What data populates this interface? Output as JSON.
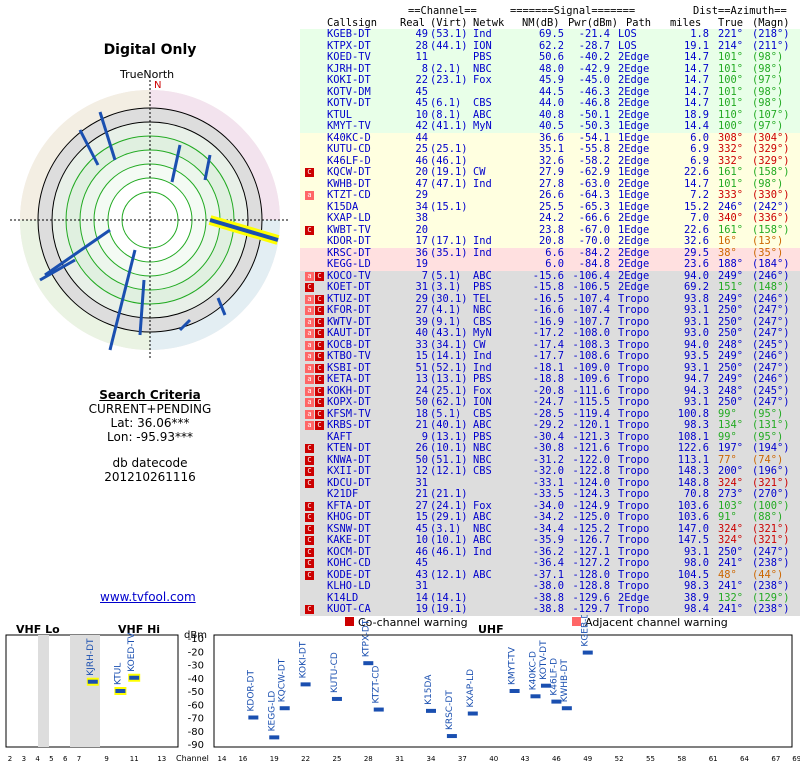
{
  "title": "Digital Only",
  "compass": {
    "truenorth": "TrueNorth",
    "n": "N"
  },
  "criteria": {
    "heading": "Search Criteria",
    "mode": "CURRENT+PENDING",
    "lat": "Lat: 36.06***",
    "lon": "Lon: -95.93***",
    "db_label": "db datecode",
    "db_value": "201210261116"
  },
  "site_link": "www.tvfool.com",
  "table": {
    "group_headers": {
      "channel": "==Channel==",
      "signal": "=======Signal=======",
      "dist": "Dist",
      "azimuth": "==Azimuth=="
    },
    "headers": [
      "Callsign",
      "Real",
      "(Virt)",
      "Netwk",
      "NM(dB)",
      "Pwr(dBm)",
      "Path",
      "miles",
      "True",
      "(Magn)"
    ],
    "rows": [
      [
        "",
        "KGEB-DT",
        "49",
        "(53.1)",
        "Ind",
        "69.5",
        "-21.4",
        "LOS",
        "1.8",
        "221°",
        "(218°)",
        "#e8ffe8",
        "#00c"
      ],
      [
        "",
        "KTPX-DT",
        "28",
        "(44.1)",
        "ION",
        "62.2",
        "-28.7",
        "LOS",
        "19.1",
        "214°",
        "(211°)",
        "#e8ffe8",
        "#00c"
      ],
      [
        "",
        "KOED-TV",
        "11",
        "",
        "PBS",
        "50.6",
        "-40.2",
        "2Edge",
        "14.7",
        "101°",
        "(98°)",
        "#e8ffe8",
        "#2a2"
      ],
      [
        "",
        "KJRH-DT",
        "8",
        "(2.1)",
        "NBC",
        "48.0",
        "-42.9",
        "2Edge",
        "14.7",
        "101°",
        "(98°)",
        "#e8ffe8",
        "#2a2"
      ],
      [
        "",
        "KOKI-DT",
        "22",
        "(23.1)",
        "Fox",
        "45.9",
        "-45.0",
        "2Edge",
        "14.7",
        "100°",
        "(97°)",
        "#e8ffe8",
        "#2a2"
      ],
      [
        "",
        "KOTV-DM",
        "45",
        "",
        "",
        "44.5",
        "-46.3",
        "2Edge",
        "14.7",
        "101°",
        "(98°)",
        "#e8ffe8",
        "#2a2"
      ],
      [
        "",
        "KOTV-DT",
        "45",
        "(6.1)",
        "CBS",
        "44.0",
        "-46.8",
        "2Edge",
        "14.7",
        "101°",
        "(98°)",
        "#e8ffe8",
        "#2a2"
      ],
      [
        "",
        "KTUL",
        "10",
        "(8.1)",
        "ABC",
        "40.8",
        "-50.1",
        "2Edge",
        "18.9",
        "110°",
        "(107°)",
        "#e8ffe8",
        "#2a2"
      ],
      [
        "",
        "KMYT-TV",
        "42",
        "(41.1)",
        "MyN",
        "40.5",
        "-50.3",
        "1Edge",
        "14.4",
        "100°",
        "(97°)",
        "#e8ffe8",
        "#2a2"
      ],
      [
        "",
        "K40KC-D",
        "44",
        "",
        "",
        "36.6",
        "-54.1",
        "1Edge",
        "6.0",
        "308°",
        "(304°)",
        "#ffffe0",
        "#c00"
      ],
      [
        "",
        "KUTU-CD",
        "25",
        "(25.1)",
        "",
        "35.1",
        "-55.8",
        "2Edge",
        "6.9",
        "332°",
        "(329°)",
        "#ffffe0",
        "#c00"
      ],
      [
        "",
        "K46LF-D",
        "46",
        "(46.1)",
        "",
        "32.6",
        "-58.2",
        "2Edge",
        "6.9",
        "332°",
        "(329°)",
        "#ffffe0",
        "#c00"
      ],
      [
        "C",
        "KQCW-DT",
        "20",
        "(19.1)",
        "CW",
        "27.9",
        "-62.9",
        "1Edge",
        "22.6",
        "161°",
        "(158°)",
        "#ffffe0",
        "#2a2"
      ],
      [
        "",
        "KWHB-DT",
        "47",
        "(47.1)",
        "Ind",
        "27.8",
        "-63.0",
        "2Edge",
        "14.7",
        "101°",
        "(98°)",
        "#ffffe0",
        "#2a2"
      ],
      [
        "a",
        "KTZT-CD",
        "29",
        "",
        "",
        "26.6",
        "-64.3",
        "1Edge",
        "7.2",
        "333°",
        "(330°)",
        "#ffffe0",
        "#c00"
      ],
      [
        "",
        "K15DA",
        "34",
        "(15.1)",
        "",
        "25.5",
        "-65.3",
        "1Edge",
        "15.2",
        "246°",
        "(242°)",
        "#ffffe0",
        "#00c"
      ],
      [
        "",
        "KXAP-LD",
        "38",
        "",
        "",
        "24.2",
        "-66.6",
        "2Edge",
        "7.0",
        "340°",
        "(336°)",
        "#ffffe0",
        "#c00"
      ],
      [
        "C",
        "KWBT-TV",
        "20",
        "",
        "",
        "23.8",
        "-67.0",
        "1Edge",
        "22.6",
        "161°",
        "(158°)",
        "#ffffe0",
        "#2a2"
      ],
      [
        "",
        "KDOR-DT",
        "17",
        "(17.1)",
        "Ind",
        "20.8",
        "-70.0",
        "2Edge",
        "32.6",
        "16°",
        "(13°)",
        "#ffffe0",
        "#c60"
      ],
      [
        "",
        "KRSC-DT",
        "36",
        "(35.1)",
        "Ind",
        "6.6",
        "-84.2",
        "2Edge",
        "29.5",
        "38°",
        "(35°)",
        "#ffe0e0",
        "#c60"
      ],
      [
        "",
        "KEGG-LD",
        "19",
        "",
        "",
        "6.0",
        "-84.8",
        "2Edge",
        "23.6",
        "188°",
        "(184°)",
        "#ffe0e0",
        "#00c"
      ],
      [
        "aC",
        "KOCO-TV",
        "7",
        "(5.1)",
        "ABC",
        "-15.6",
        "-106.4",
        "2Edge",
        "94.0",
        "249°",
        "(246°)",
        "#ddd",
        "#00c"
      ],
      [
        "C",
        "KOET-DT",
        "31",
        "(3.1)",
        "PBS",
        "-15.8",
        "-106.5",
        "2Edge",
        "69.2",
        "151°",
        "(148°)",
        "#ddd",
        "#2a2"
      ],
      [
        "aC",
        "KTUZ-DT",
        "29",
        "(30.1)",
        "TEL",
        "-16.5",
        "-107.4",
        "Tropo",
        "93.8",
        "249°",
        "(246°)",
        "#ddd",
        "#00c"
      ],
      [
        "aC",
        "KFOR-DT",
        "27",
        "(4.1)",
        "NBC",
        "-16.6",
        "-107.4",
        "Tropo",
        "93.1",
        "250°",
        "(247°)",
        "#ddd",
        "#00c"
      ],
      [
        "aC",
        "KWTV-DT",
        "39",
        "(9.1)",
        "CBS",
        "-16.9",
        "-107.7",
        "Tropo",
        "93.1",
        "250°",
        "(247°)",
        "#ddd",
        "#00c"
      ],
      [
        "aC",
        "KAUT-DT",
        "40",
        "(43.1)",
        "MyN",
        "-17.2",
        "-108.0",
        "Tropo",
        "93.0",
        "250°",
        "(247°)",
        "#ddd",
        "#00c"
      ],
      [
        "aC",
        "KOCB-DT",
        "33",
        "(34.1)",
        "CW",
        "-17.4",
        "-108.3",
        "Tropo",
        "94.0",
        "248°",
        "(245°)",
        "#ddd",
        "#00c"
      ],
      [
        "aC",
        "KTBO-TV",
        "15",
        "(14.1)",
        "Ind",
        "-17.7",
        "-108.6",
        "Tropo",
        "93.5",
        "249°",
        "(246°)",
        "#ddd",
        "#00c"
      ],
      [
        "aC",
        "KSBI-DT",
        "51",
        "(52.1)",
        "Ind",
        "-18.1",
        "-109.0",
        "Tropo",
        "93.1",
        "250°",
        "(247°)",
        "#ddd",
        "#00c"
      ],
      [
        "aC",
        "KETA-DT",
        "13",
        "(13.1)",
        "PBS",
        "-18.8",
        "-109.6",
        "Tropo",
        "94.7",
        "249°",
        "(246°)",
        "#ddd",
        "#00c"
      ],
      [
        "aC",
        "KOKH-DT",
        "24",
        "(25.1)",
        "Fox",
        "-20.8",
        "-111.6",
        "Tropo",
        "94.3",
        "248°",
        "(245°)",
        "#ddd",
        "#00c"
      ],
      [
        "aC",
        "KOPX-DT",
        "50",
        "(62.1)",
        "ION",
        "-24.7",
        "-115.5",
        "Tropo",
        "93.1",
        "250°",
        "(247°)",
        "#ddd",
        "#00c"
      ],
      [
        "aC",
        "KFSM-TV",
        "18",
        "(5.1)",
        "CBS",
        "-28.5",
        "-119.4",
        "Tropo",
        "100.8",
        "99°",
        "(95°)",
        "#ddd",
        "#2a2"
      ],
      [
        "aC",
        "KRBS-DT",
        "21",
        "(40.1)",
        "ABC",
        "-29.2",
        "-120.1",
        "Tropo",
        "98.3",
        "134°",
        "(131°)",
        "#ddd",
        "#2a2"
      ],
      [
        "",
        "KAFT",
        "9",
        "(13.1)",
        "PBS",
        "-30.4",
        "-121.3",
        "Tropo",
        "108.1",
        "99°",
        "(95°)",
        "#ddd",
        "#2a2"
      ],
      [
        "C",
        "KTEN-DT",
        "26",
        "(10.1)",
        "NBC",
        "-30.8",
        "-121.6",
        "Tropo",
        "122.6",
        "197°",
        "(194°)",
        "#ddd",
        "#00c"
      ],
      [
        "C",
        "KNWA-DT",
        "50",
        "(51.1)",
        "NBC",
        "-31.2",
        "-122.0",
        "Tropo",
        "113.1",
        "77°",
        "(74°)",
        "#ddd",
        "#c60"
      ],
      [
        "C",
        "KXII-DT",
        "12",
        "(12.1)",
        "CBS",
        "-32.0",
        "-122.8",
        "Tropo",
        "148.3",
        "200°",
        "(196°)",
        "#ddd",
        "#00c"
      ],
      [
        "C",
        "KDCU-DT",
        "31",
        "",
        "",
        "-33.1",
        "-124.0",
        "Tropo",
        "148.8",
        "324°",
        "(321°)",
        "#ddd",
        "#c00"
      ],
      [
        "",
        "K21DF",
        "21",
        "(21.1)",
        "",
        "-33.5",
        "-124.3",
        "Tropo",
        "70.8",
        "273°",
        "(270°)",
        "#ddd",
        "#00c"
      ],
      [
        "C",
        "KFTA-DT",
        "27",
        "(24.1)",
        "Fox",
        "-34.0",
        "-124.9",
        "Tropo",
        "103.6",
        "103°",
        "(100°)",
        "#ddd",
        "#2a2"
      ],
      [
        "C",
        "KHOG-DT",
        "15",
        "(29.1)",
        "ABC",
        "-34.2",
        "-125.0",
        "Tropo",
        "103.6",
        "91°",
        "(88°)",
        "#ddd",
        "#2a2"
      ],
      [
        "C",
        "KSNW-DT",
        "45",
        "(3.1)",
        "NBC",
        "-34.4",
        "-125.2",
        "Tropo",
        "147.0",
        "324°",
        "(321°)",
        "#ddd",
        "#c00"
      ],
      [
        "C",
        "KAKE-DT",
        "10",
        "(10.1)",
        "ABC",
        "-35.9",
        "-126.7",
        "Tropo",
        "147.5",
        "324°",
        "(321°)",
        "#ddd",
        "#c00"
      ],
      [
        "C",
        "KOCM-DT",
        "46",
        "(46.1)",
        "Ind",
        "-36.2",
        "-127.1",
        "Tropo",
        "93.1",
        "250°",
        "(247°)",
        "#ddd",
        "#00c"
      ],
      [
        "C",
        "KOHC-CD",
        "45",
        "",
        "",
        "-36.4",
        "-127.2",
        "Tropo",
        "98.0",
        "241°",
        "(238°)",
        "#ddd",
        "#00c"
      ],
      [
        "C",
        "KODE-DT",
        "43",
        "(12.1)",
        "ABC",
        "-37.1",
        "-128.0",
        "Tropo",
        "104.5",
        "48°",
        "(44°)",
        "#ddd",
        "#c60"
      ],
      [
        "",
        "KLHO-LD",
        "31",
        "",
        "",
        "-38.0",
        "-128.8",
        "Tropo",
        "98.3",
        "241°",
        "(238°)",
        "#ddd",
        "#00c"
      ],
      [
        "",
        "K14LD",
        "14",
        "(14.1)",
        "",
        "-38.8",
        "-129.6",
        "2Edge",
        "38.9",
        "132°",
        "(129°)",
        "#ddd",
        "#2a2"
      ],
      [
        "C",
        "KUOT-CA",
        "19",
        "(19.1)",
        "",
        "-38.8",
        "-129.7",
        "Tropo",
        "98.4",
        "241°",
        "(238°)",
        "#ddd",
        "#00c"
      ]
    ]
  },
  "bottom": {
    "vhf_lo": "VHF Lo",
    "vhf_hi": "VHF Hi",
    "uhf": "UHF",
    "dbm": "dBm",
    "channel": "Channel",
    "co_warning": "Co-channel warning",
    "adj_warning": "Adjacent channel warning",
    "yticks": [
      "-10",
      "-20",
      "-30",
      "-40",
      "-50",
      "-60",
      "-70",
      "-80",
      "-90"
    ],
    "xticks_vhf": [
      "2",
      "3",
      "4",
      "5",
      "6",
      "7",
      "9",
      "11",
      "13"
    ],
    "xticks_uhf": [
      "14",
      "16",
      "19",
      "22",
      "25",
      "28",
      "31",
      "34",
      "37",
      "40",
      "43",
      "46",
      "49",
      "52",
      "55",
      "58",
      "61",
      "64",
      "67",
      "69"
    ],
    "vhf_bars": [
      {
        "label": "KJRH-DT",
        "ch": 8,
        "dbm": -43
      },
      {
        "label": "KTUL",
        "ch": 10,
        "dbm": -50
      },
      {
        "label": "KOED-TV",
        "ch": 11,
        "dbm": -40
      }
    ],
    "uhf_bars": [
      {
        "label": "KDOR-DT",
        "ch": 17,
        "dbm": -70
      },
      {
        "label": "KEGG-LD",
        "ch": 19,
        "dbm": -85
      },
      {
        "label": "KQCW-DT",
        "ch": 20,
        "dbm": -63
      },
      {
        "label": "KOKI-DT",
        "ch": 22,
        "dbm": -45
      },
      {
        "label": "KUTU-CD",
        "ch": 25,
        "dbm": -56
      },
      {
        "label": "KTPX-DT",
        "ch": 28,
        "dbm": -29
      },
      {
        "label": "KTZT-CD",
        "ch": 29,
        "dbm": -64
      },
      {
        "label": "K15DA",
        "ch": 34,
        "dbm": -65
      },
      {
        "label": "KRSC-DT",
        "ch": 36,
        "dbm": -84
      },
      {
        "label": "KXAP-LD",
        "ch": 38,
        "dbm": -67
      },
      {
        "label": "KMYT-TV",
        "ch": 42,
        "dbm": -50
      },
      {
        "label": "K40KC-D",
        "ch": 44,
        "dbm": -54
      },
      {
        "label": "KOTV-DT",
        "ch": 45,
        "dbm": -46
      },
      {
        "label": "K46LF-D",
        "ch": 46,
        "dbm": -58
      },
      {
        "label": "KWHB-DT",
        "ch": 47,
        "dbm": -63
      },
      {
        "label": "KGEB-DT",
        "ch": 49,
        "dbm": -21
      }
    ]
  }
}
